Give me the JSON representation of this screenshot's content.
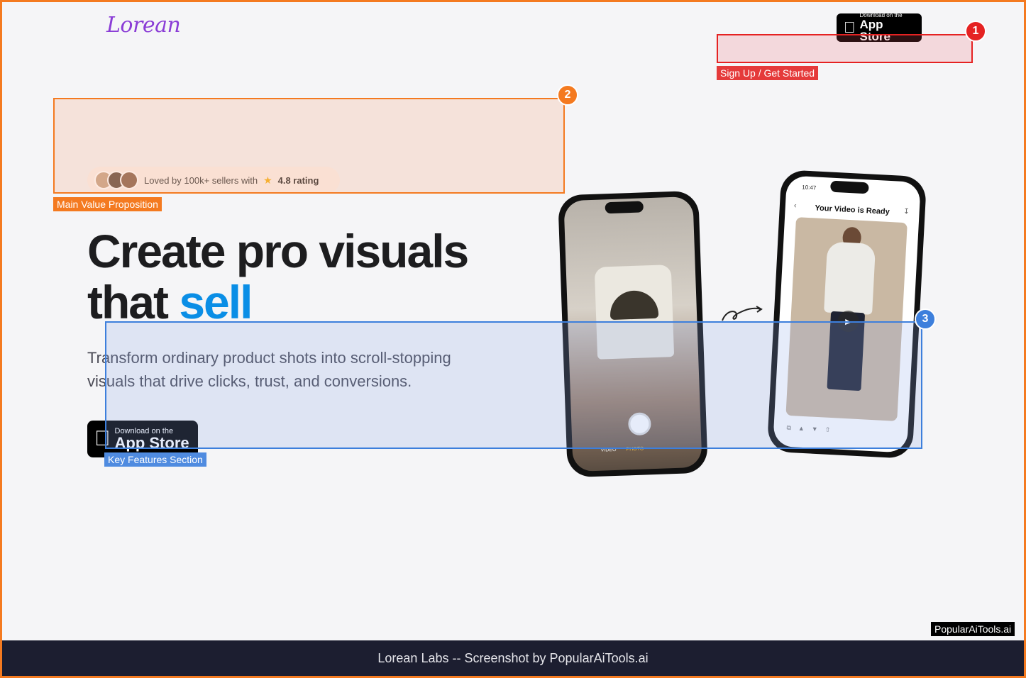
{
  "header": {
    "logo": "Lorean",
    "app_store_small": "Download on the",
    "app_store_big": "App Store"
  },
  "annotations": [
    {
      "number": "1",
      "label": "Sign Up / Get Started",
      "color": "#e52222"
    },
    {
      "number": "2",
      "label": "Main Value Proposition",
      "color": "#f47a20"
    },
    {
      "number": "3",
      "label": "Key Features Section",
      "color": "#3d7fdc"
    }
  ],
  "hero": {
    "rating_text": "Loved by 100k+ sellers with",
    "rating_value": "4.8 rating",
    "headline_line1": "Create pro visuals",
    "headline_line2_prefix": "that ",
    "headline_accent": "sell",
    "subtitle": "Transform ordinary product shots into scroll-stopping visuals that drive clicks, trust, and conversions.",
    "app_store_small": "Download on the",
    "app_store_big": "App Store",
    "accent_color": "#0a8ee6"
  },
  "phone_left": {
    "mode_video": "VIDEO",
    "mode_photo": "PHOTO"
  },
  "phone_right": {
    "time": "10:47",
    "title": "Your Video is Ready"
  },
  "watermark": "PopularAiTools.ai",
  "footer": "Lorean Labs -- Screenshot by PopularAiTools.ai"
}
